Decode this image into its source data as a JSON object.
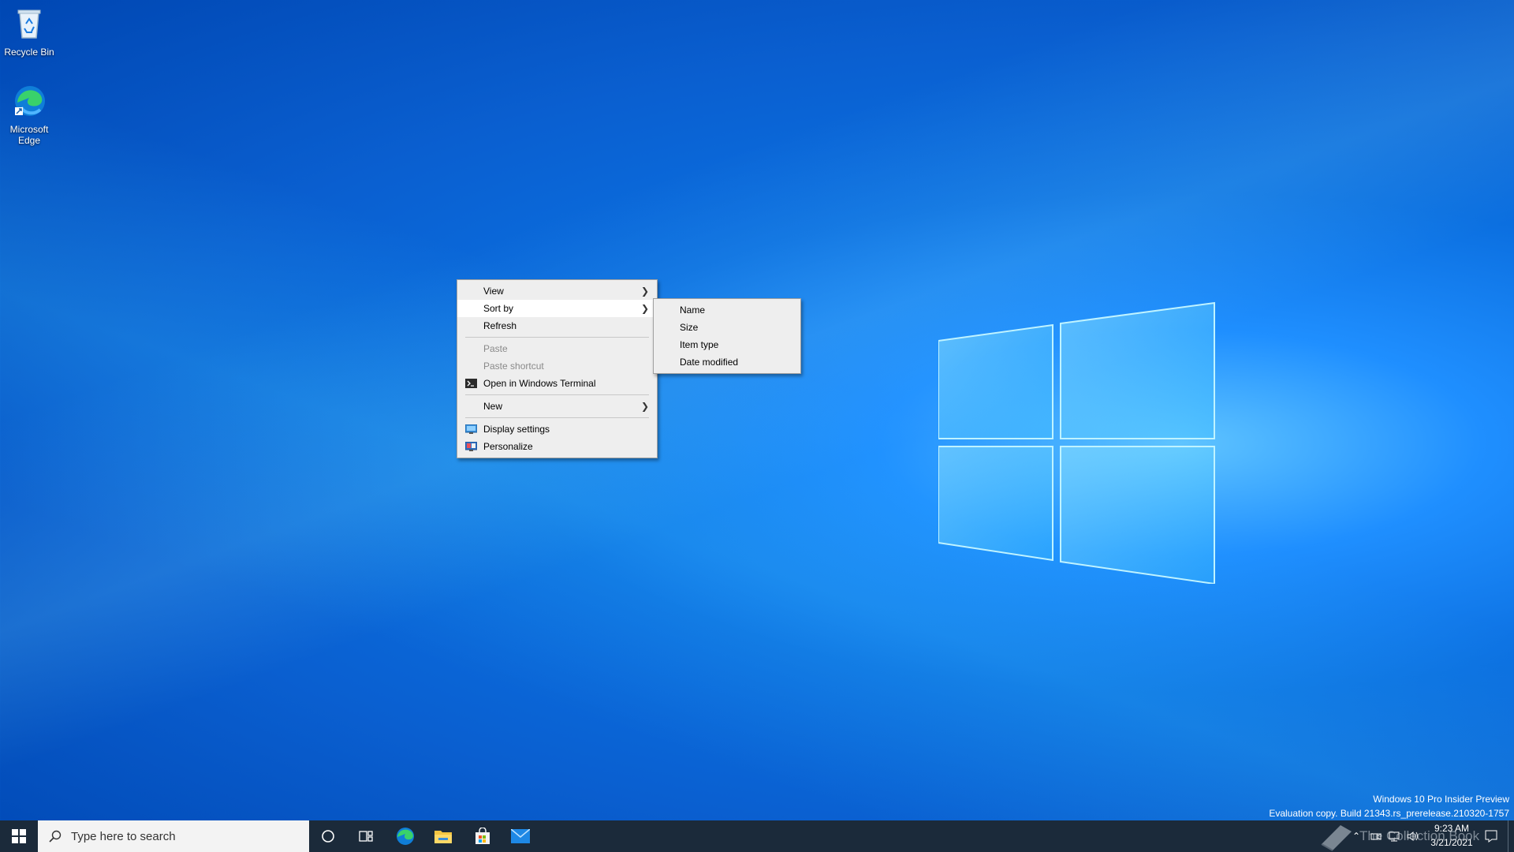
{
  "desktop": {
    "icons": [
      {
        "label": "Recycle Bin"
      },
      {
        "label": "Microsoft Edge"
      }
    ]
  },
  "context_menu": {
    "items": [
      {
        "label": "View",
        "submenu": true
      },
      {
        "label": "Sort by",
        "submenu": true,
        "highlighted": true
      },
      {
        "label": "Refresh"
      },
      {
        "label": "Paste",
        "disabled": true
      },
      {
        "label": "Paste shortcut",
        "disabled": true
      },
      {
        "label": "Open in Windows Terminal",
        "icon": "terminal-icon"
      },
      {
        "label": "New",
        "submenu": true
      },
      {
        "label": "Display settings",
        "icon": "display-icon"
      },
      {
        "label": "Personalize",
        "icon": "personalize-icon"
      }
    ]
  },
  "sort_submenu": {
    "items": [
      {
        "label": "Name"
      },
      {
        "label": "Size"
      },
      {
        "label": "Item type"
      },
      {
        "label": "Date modified"
      }
    ]
  },
  "taskbar": {
    "search_placeholder": "Type here to search",
    "pinned": [
      "cortana-icon",
      "task-view-icon",
      "edge-icon",
      "file-explorer-icon",
      "store-icon",
      "mail-icon"
    ],
    "clock_time": "9:23 AM",
    "clock_date": "3/21/2021"
  },
  "watermark": {
    "line1": "Windows 10 Pro Insider Preview",
    "line2": "Evaluation copy. Build 21343.rs_prerelease.210320-1757"
  },
  "overlay_text": "The Collection Book",
  "colors": {
    "accent": "#0078d7",
    "taskbar": "#1b2a3a",
    "menu_bg": "#eeeeee"
  }
}
